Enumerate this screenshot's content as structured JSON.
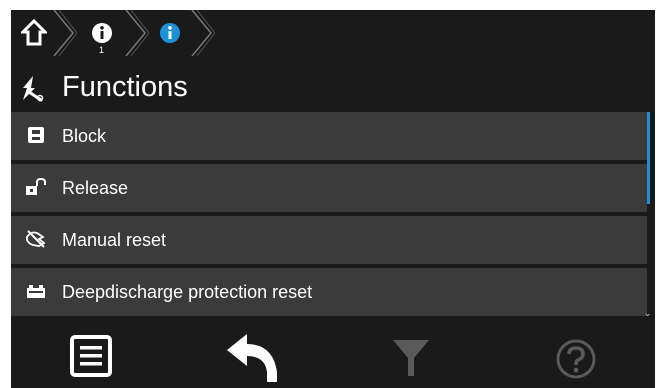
{
  "breadcrumb": {
    "items": [
      {
        "icon": "home-icon"
      },
      {
        "icon": "info-icon",
        "sub": "1"
      },
      {
        "icon": "info-icon-active"
      }
    ]
  },
  "title": {
    "icon": "tools-icon",
    "text": "Functions"
  },
  "list": {
    "items": [
      {
        "icon": "lock-closed-icon",
        "label": "Block"
      },
      {
        "icon": "lock-open-icon",
        "label": "Release"
      },
      {
        "icon": "manual-reset-icon",
        "label": "Manual reset"
      },
      {
        "icon": "battery-icon",
        "label": "Deepdischarge protection reset"
      }
    ]
  },
  "toolbar": {
    "buttons": [
      {
        "icon": "menu-list-icon"
      },
      {
        "icon": "back-arrow-icon"
      },
      {
        "icon": "filter-icon"
      },
      {
        "icon": "help-icon"
      }
    ]
  },
  "colors": {
    "background": "#1a1a1a",
    "item": "#3b3b3b",
    "accent": "#1e90d8",
    "disabled": "#5a5a5a"
  }
}
